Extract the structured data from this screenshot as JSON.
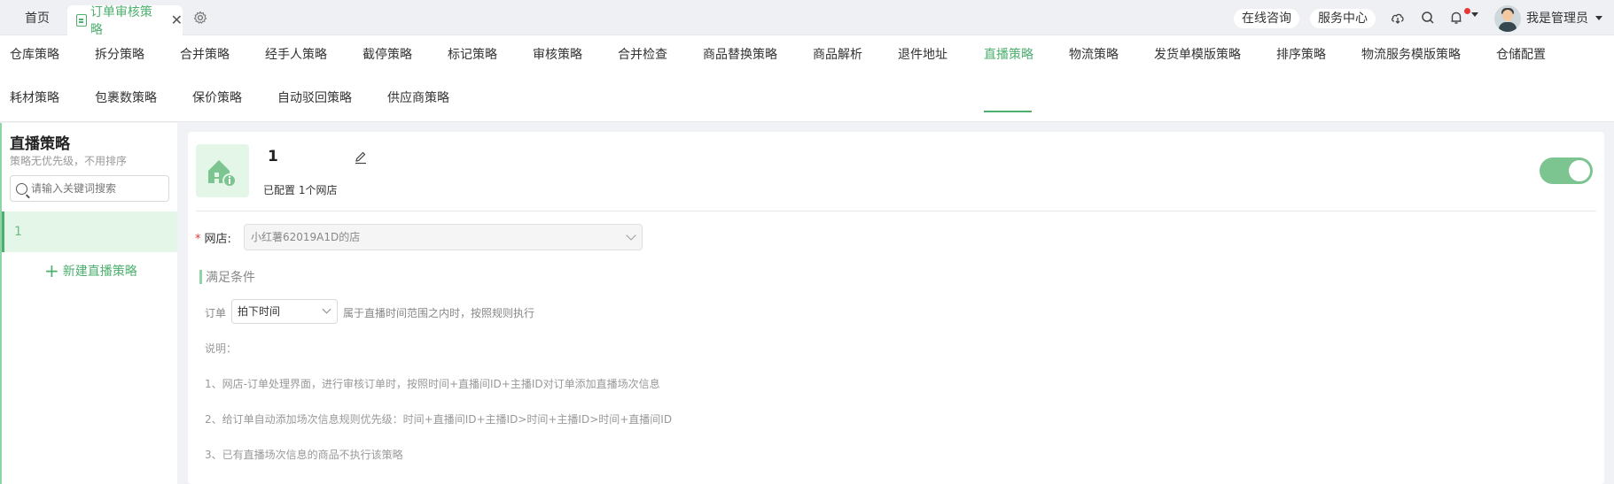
{
  "topbar": {
    "home_tab": "首页",
    "active_tab": "订单审核策略",
    "close_glyph": "✕",
    "consult": "在线咨询",
    "service": "服务中心",
    "user_name": "我是管理员"
  },
  "nav": {
    "items": [
      "仓库策略",
      "拆分策略",
      "合并策略",
      "经手人策略",
      "截停策略",
      "标记策略",
      "审核策略",
      "合并检查",
      "商品替换策略",
      "商品解析",
      "退件地址",
      "直播策略",
      "物流策略",
      "发货单模版策略",
      "排序策略",
      "物流服务模版策略",
      "仓储配置",
      "耗材策略",
      "包裹数策略",
      "保价策略",
      "自动驳回策略",
      "供应商策略"
    ],
    "active_index": 11
  },
  "left": {
    "title": "直播策略",
    "subtitle": "策略无优先级，不用排序",
    "search_placeholder": "请输入关键词搜索",
    "item_label": "1",
    "new_label": "新建直播策略"
  },
  "main": {
    "strategy_name": "1",
    "configured": "已配置 1个网店",
    "enabled": true,
    "shop_label": "网店:",
    "shop_required": "*",
    "shop_value": "小红薯62019A1D的店",
    "condition_title": "满足条件",
    "order_label": "订单",
    "order_value": "拍下时间",
    "order_tail": "属于直播时间范围之内时，按照规则执行",
    "notes": [
      "说明：",
      "1、网店-订单处理界面，进行审核订单时，按照时间+直播间ID+主播ID对订单添加直播场次信息",
      "2、给订单自动添加场次信息规则优先级：时间+直播间ID+主播ID>时间+主播ID>时间+直播间ID",
      "3、已有直播场次信息的商品不执行该策略"
    ]
  },
  "colors": {
    "accent": "#4caf6e",
    "toggle": "#7cc490",
    "selected_bg": "#e3f6e8"
  }
}
